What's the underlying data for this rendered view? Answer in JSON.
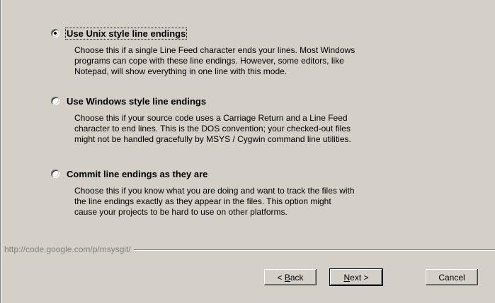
{
  "options": [
    {
      "label": "Use Unix style line endings",
      "selected": true,
      "description": [
        "Choose this if a single Line Feed character ends your lines. Most Windows",
        "programs can cope with these line endings. However, some editors, like",
        "Notepad, will show everything in one line with this mode."
      ]
    },
    {
      "label": "Use Windows style line endings",
      "selected": false,
      "description": [
        "Choose this if your source code uses a Carriage Return and a Line Feed",
        "character to end lines. This is the DOS convention; your checked-out files",
        "might not be handled gracefully by MSYS / Cygwin command line utilities."
      ]
    },
    {
      "label": "Commit line endings as they are",
      "selected": false,
      "description": [
        "Choose this if you know what you are doing and want to track the files with",
        "the line endings exactly as they appear in the files. This option might",
        "cause your projects to be hard to use on other platforms."
      ]
    }
  ],
  "footer": {
    "url": "http://code.google.com/p/msysgit/"
  },
  "buttons": {
    "back": {
      "prefix": "< ",
      "accel": "B",
      "rest": "ack"
    },
    "next": {
      "prefix": "",
      "accel": "N",
      "rest": "ext >"
    },
    "cancel": {
      "label": "Cancel"
    }
  }
}
